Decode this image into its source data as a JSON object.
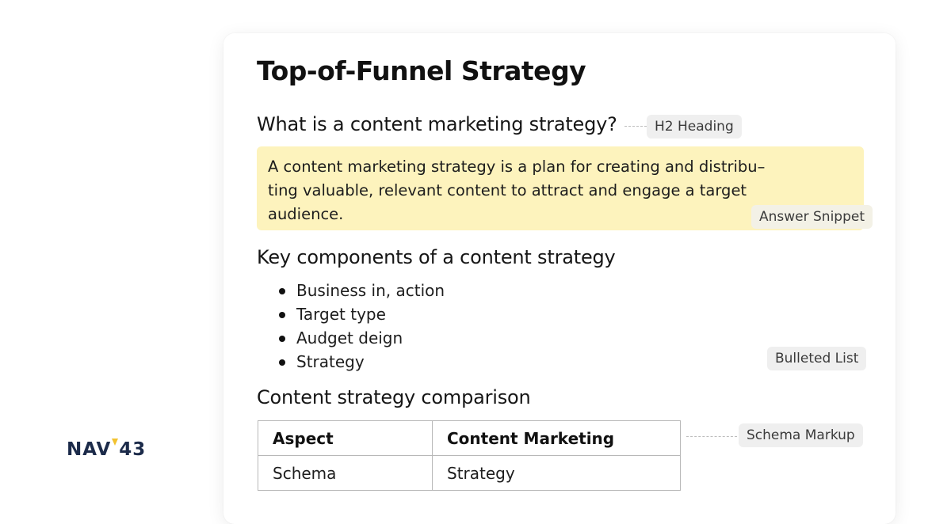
{
  "brand": {
    "logo_left": "NAV",
    "logo_right": "43",
    "accent": "#f2c230",
    "color": "#1c2b4a"
  },
  "page": {
    "title": "Top-of-Funnel Strategy",
    "question_heading": "What is a content marketing strategy?",
    "answer": "A content marketing strategy is a plan for creating and distribu–ting valuable, relevant content to attract and engage a target audience.",
    "components_heading": "Key components of a content strategy",
    "components": [
      "Business in, action",
      "Target type",
      "Audget deign",
      "Strategy"
    ],
    "comparison_heading": "Content strategy comparison",
    "table": {
      "headers": [
        "Aspect",
        "Content Marketing"
      ],
      "rows": [
        [
          "Schema",
          "Strategy"
        ]
      ]
    }
  },
  "annotations": {
    "h2": "H2 Heading",
    "answer": "Answer Snippet",
    "list": "Bulleted List",
    "schema": "Schema Markup"
  },
  "colors": {
    "snippet_bg": "#fdf3bd",
    "tag_bg": "#efefef"
  }
}
